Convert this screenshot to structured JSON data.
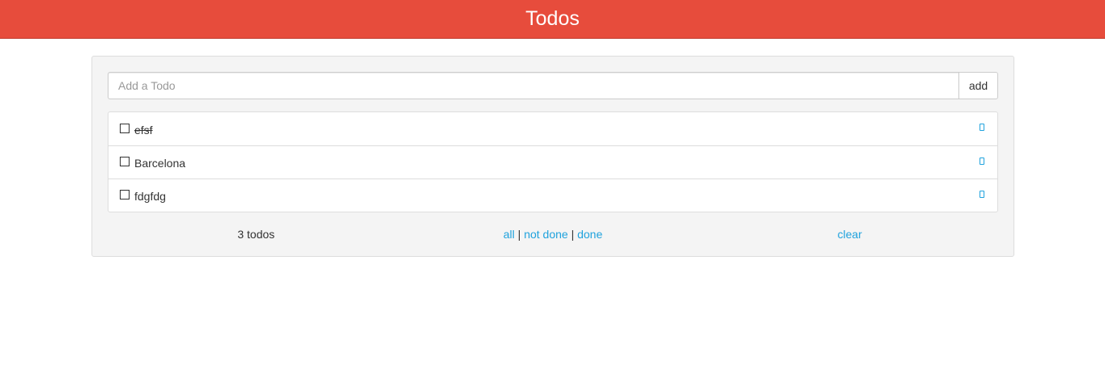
{
  "header": {
    "title": "Todos"
  },
  "add_form": {
    "placeholder": "Add a Todo",
    "value": "",
    "button_label": "add"
  },
  "todos": [
    {
      "text": "efsf",
      "done": true,
      "checked": false
    },
    {
      "text": "Barcelona",
      "done": false,
      "checked": false
    },
    {
      "text": "fdgfdg",
      "done": false,
      "checked": false
    }
  ],
  "footer": {
    "count_label": "3 todos",
    "filters": {
      "all": "all",
      "not_done": "not done",
      "done": "done",
      "separator": "|"
    },
    "clear_label": "clear"
  },
  "colors": {
    "header_bg": "#e74c3c",
    "link": "#1fa2dd"
  },
  "icons": {
    "checkbox": "checkbox-empty-icon",
    "remove": "remove-icon"
  }
}
